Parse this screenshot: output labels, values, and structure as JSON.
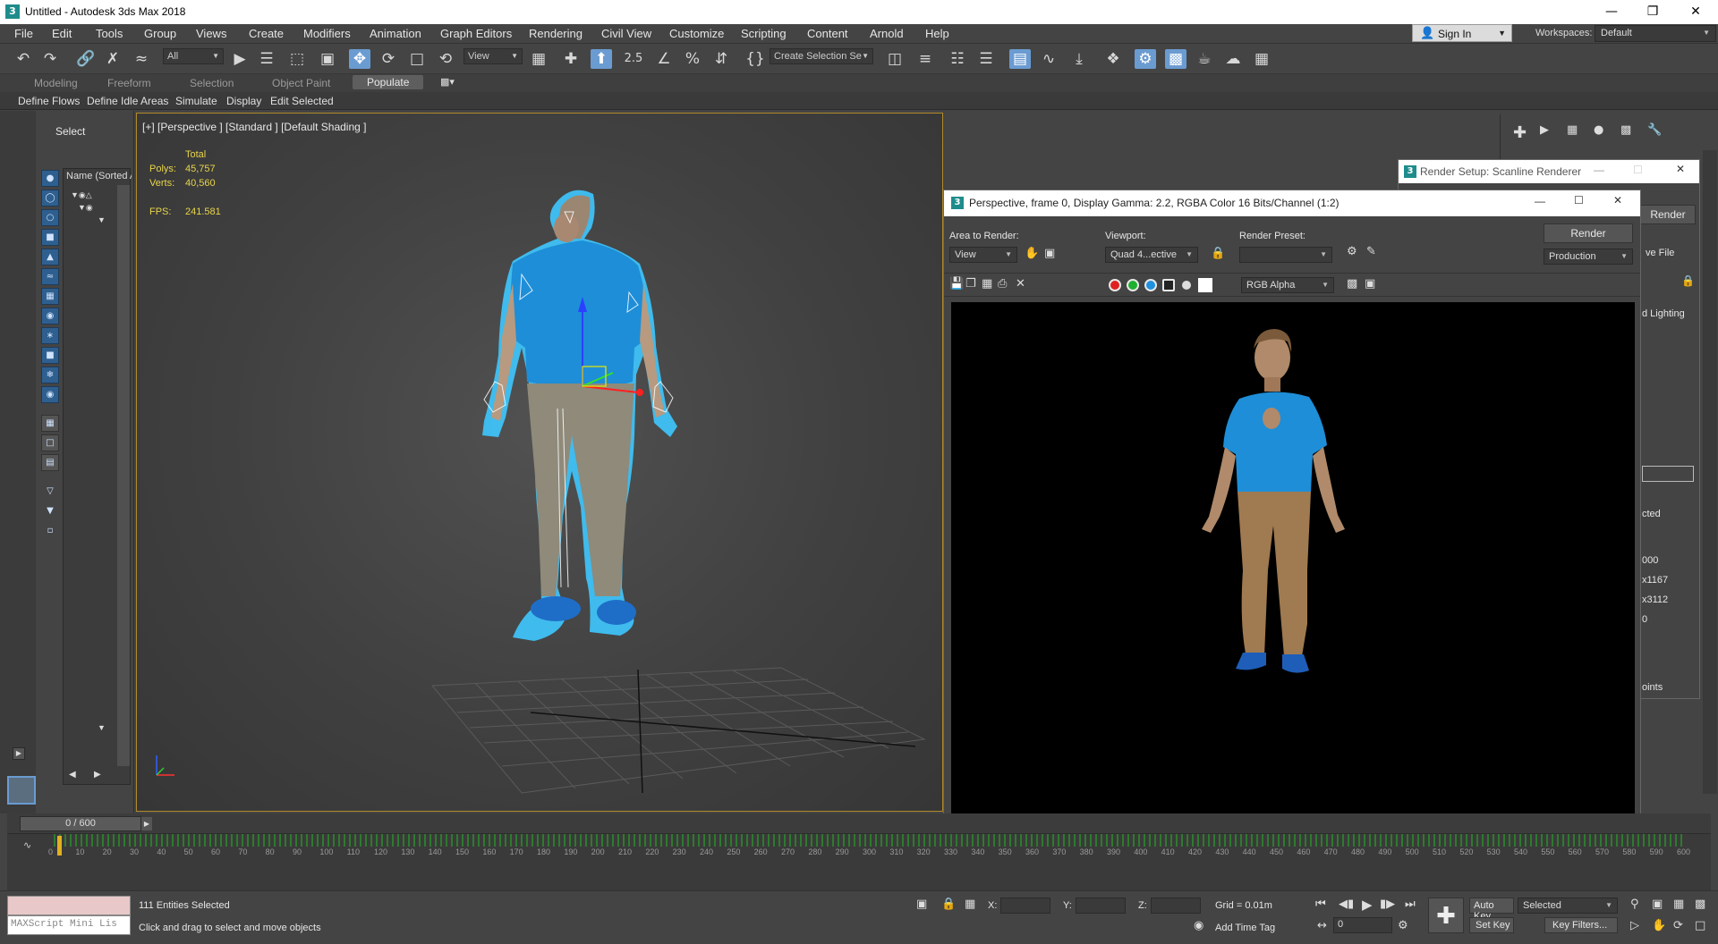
{
  "window": {
    "title": "Untitled - Autodesk 3ds Max 2018",
    "app_icon": "3"
  },
  "menubar": {
    "items": [
      "File",
      "Edit",
      "Tools",
      "Group",
      "Views",
      "Create",
      "Modifiers",
      "Animation",
      "Graph Editors",
      "Rendering",
      "Civil View",
      "Customize",
      "Scripting",
      "Content",
      "Arnold",
      "Help"
    ],
    "sign_in": "Sign In",
    "workspaces_label": "Workspaces:",
    "workspace_value": "Default"
  },
  "toolbar": {
    "selection_filter": "All",
    "reference_coord": "View",
    "named_selection": "Create Selection Se",
    "snap_value": "2.5"
  },
  "ribbon": {
    "tabs": [
      "Modeling",
      "Freeform",
      "Selection",
      "Object Paint",
      "Populate"
    ],
    "active_tab": "Populate",
    "buttons": [
      "Define Flows",
      "Define Idle Areas",
      "Simulate",
      "Display",
      "Edit Selected"
    ]
  },
  "scene_explorer": {
    "select_label": "Select",
    "column_header": "Name (Sorted A"
  },
  "viewport": {
    "label": "[+] [Perspective ] [Standard ] [Default Shading ]",
    "stats": {
      "total_label": "Total",
      "polys_label": "Polys:",
      "polys_value": "45,757",
      "verts_label": "Verts:",
      "verts_value": "40,560",
      "fps_label": "FPS:",
      "fps_value": "241.581"
    }
  },
  "render_frame": {
    "title": "Perspective, frame 0, Display Gamma: 2.2, RGBA Color 16 Bits/Channel (1:2)",
    "area_label": "Area to Render:",
    "area_value": "View",
    "viewport_label": "Viewport:",
    "viewport_value": "Quad 4...ective",
    "preset_label": "Render Preset:",
    "preset_value": "",
    "render_button": "Render",
    "mode_value": "Production",
    "channel_value": "RGB Alpha"
  },
  "render_setup": {
    "title": "Render Setup: Scanline Renderer",
    "render_partial": "Render",
    "save_file_partial": "ve File",
    "lighting_partial": "d Lighting",
    "selected_partial": "cted",
    "v000": "000",
    "v1167": "x1167",
    "v3112": "x3112",
    "v0": "0",
    "points_partial": "oints"
  },
  "timeslider": {
    "value": "0 / 600",
    "ticks": [
      "0",
      "10",
      "20",
      "30",
      "40",
      "50",
      "60",
      "70",
      "80",
      "90",
      "100",
      "110",
      "120",
      "130",
      "140",
      "150",
      "160",
      "170",
      "180",
      "190",
      "200",
      "210",
      "220",
      "230",
      "240",
      "250",
      "260",
      "270",
      "280",
      "290",
      "300",
      "310",
      "320",
      "330",
      "340",
      "350",
      "360",
      "370",
      "380",
      "390",
      "400",
      "410",
      "420",
      "430",
      "440",
      "450",
      "460",
      "470",
      "480",
      "490",
      "500",
      "510",
      "520",
      "530",
      "540",
      "550",
      "560",
      "570",
      "580",
      "590",
      "600"
    ]
  },
  "statusbar": {
    "maxscript_label": "MAXScript Mini Lis",
    "entities": "111 Entities Selected",
    "prompt": "Click and drag to select and move objects",
    "x_label": "X:",
    "y_label": "Y:",
    "z_label": "Z:",
    "grid": "Grid = 0.01m",
    "add_time_tag": "Add Time Tag",
    "frame_value": "0",
    "auto_key": "Auto Key",
    "set_key": "Set Key",
    "key_mode": "Selected",
    "key_filters": "Key Filters..."
  },
  "colors": {
    "selection_cyan": "#3ec8ff",
    "shirt_blue": "#1e8ed8",
    "pants_tan": "#a08055",
    "active_blue": "#6a9bd1",
    "viewport_border": "#b08a2a"
  }
}
